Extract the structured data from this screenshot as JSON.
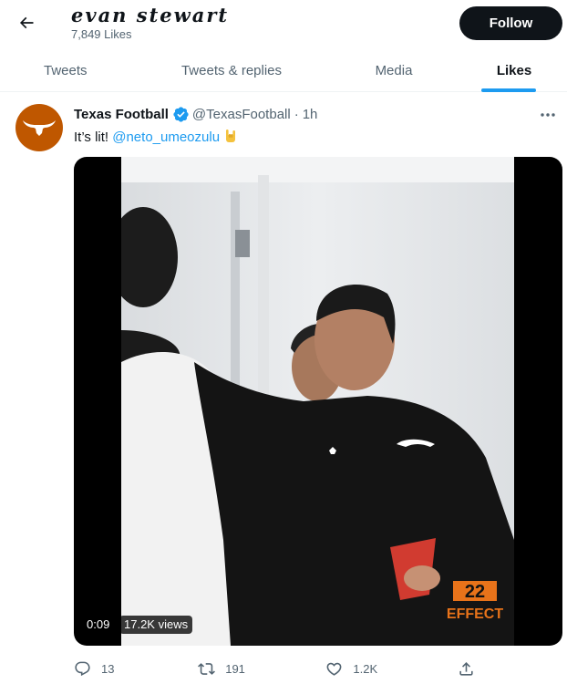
{
  "header": {
    "back_icon": "arrow-left-icon",
    "name": "evan stewart",
    "likes_count": "7,849 Likes",
    "follow_label": "Follow"
  },
  "tabs": [
    {
      "label": "Tweets",
      "active": false
    },
    {
      "label": "Tweets & replies",
      "active": false
    },
    {
      "label": "Media",
      "active": false
    },
    {
      "label": "Likes",
      "active": true
    }
  ],
  "tweet": {
    "author_name": "Texas Football",
    "verified_icon": "verified-badge-icon",
    "handle": "@TexasFootball",
    "separator": "·",
    "time": "1h",
    "text": "It’s lit! ",
    "mention": "@neto_umeozulu",
    "emoji_icon": "rock-on-hand-icon",
    "video": {
      "timer": "0:09",
      "views": "17.2K views",
      "overlay_top": "22",
      "overlay_bottom": "EFFECT"
    },
    "actions": {
      "replies": "13",
      "retweets": "191",
      "likes": "1.2K"
    }
  },
  "colors": {
    "accent": "#1d9bf0",
    "text": "#0f1419",
    "secondary": "#536471",
    "texas_orange": "#bf5700"
  }
}
